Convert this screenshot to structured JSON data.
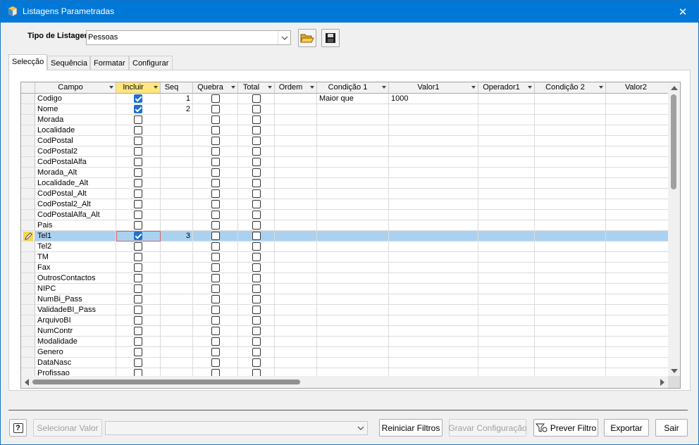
{
  "window": {
    "title": "Listagens Parametradas",
    "close_glyph": "✕"
  },
  "tipo": {
    "label": "Tipo de Listagem",
    "value": "Pessoas"
  },
  "tabs": [
    {
      "label": "Selecção",
      "active": true
    },
    {
      "label": "Sequência",
      "active": false
    },
    {
      "label": "Formatar",
      "active": false
    },
    {
      "label": "Configurar",
      "active": false
    }
  ],
  "grid": {
    "columns": [
      "Campo",
      "Incluir",
      "Seq",
      "Quebra",
      "Total",
      "Ordem",
      "Condição 1",
      "Valor1",
      "Operador1",
      "Condição 2",
      "Valor2"
    ],
    "sorted_column": "Incluir",
    "rows": [
      {
        "campo": "Codigo",
        "incluir": true,
        "seq": "1",
        "quebra": false,
        "total": false,
        "cond1": "Maior que",
        "valor1": "1000"
      },
      {
        "campo": "Nome",
        "incluir": true,
        "seq": "2",
        "quebra": false,
        "total": false,
        "cond1": "",
        "valor1": ""
      },
      {
        "campo": "Morada",
        "incluir": false,
        "seq": "",
        "quebra": false,
        "total": false,
        "cond1": "",
        "valor1": ""
      },
      {
        "campo": "Localidade",
        "incluir": false,
        "seq": "",
        "quebra": false,
        "total": false,
        "cond1": "",
        "valor1": ""
      },
      {
        "campo": "CodPostal",
        "incluir": false,
        "seq": "",
        "quebra": false,
        "total": false,
        "cond1": "",
        "valor1": ""
      },
      {
        "campo": "CodPostal2",
        "incluir": false,
        "seq": "",
        "quebra": false,
        "total": false,
        "cond1": "",
        "valor1": ""
      },
      {
        "campo": "CodPostalAlfa",
        "incluir": false,
        "seq": "",
        "quebra": false,
        "total": false,
        "cond1": "",
        "valor1": ""
      },
      {
        "campo": "Morada_Alt",
        "incluir": false,
        "seq": "",
        "quebra": false,
        "total": false,
        "cond1": "",
        "valor1": ""
      },
      {
        "campo": "Localidade_Alt",
        "incluir": false,
        "seq": "",
        "quebra": false,
        "total": false,
        "cond1": "",
        "valor1": ""
      },
      {
        "campo": "CodPostal_Alt",
        "incluir": false,
        "seq": "",
        "quebra": false,
        "total": false,
        "cond1": "",
        "valor1": ""
      },
      {
        "campo": "CodPostal2_Alt",
        "incluir": false,
        "seq": "",
        "quebra": false,
        "total": false,
        "cond1": "",
        "valor1": ""
      },
      {
        "campo": "CodPostalAlfa_Alt",
        "incluir": false,
        "seq": "",
        "quebra": false,
        "total": false,
        "cond1": "",
        "valor1": ""
      },
      {
        "campo": "Pais",
        "incluir": false,
        "seq": "",
        "quebra": false,
        "total": false,
        "cond1": "",
        "valor1": ""
      },
      {
        "campo": "Tel1",
        "incluir": true,
        "seq": "3",
        "quebra": false,
        "total": false,
        "cond1": "",
        "valor1": "",
        "selected": true
      },
      {
        "campo": "Tel2",
        "incluir": false,
        "seq": "",
        "quebra": false,
        "total": false,
        "cond1": "",
        "valor1": ""
      },
      {
        "campo": "TM",
        "incluir": false,
        "seq": "",
        "quebra": false,
        "total": false,
        "cond1": "",
        "valor1": ""
      },
      {
        "campo": "Fax",
        "incluir": false,
        "seq": "",
        "quebra": false,
        "total": false,
        "cond1": "",
        "valor1": ""
      },
      {
        "campo": "OutrosContactos",
        "incluir": false,
        "seq": "",
        "quebra": false,
        "total": false,
        "cond1": "",
        "valor1": ""
      },
      {
        "campo": "NIPC",
        "incluir": false,
        "seq": "",
        "quebra": false,
        "total": false,
        "cond1": "",
        "valor1": ""
      },
      {
        "campo": "NumBi_Pass",
        "incluir": false,
        "seq": "",
        "quebra": false,
        "total": false,
        "cond1": "",
        "valor1": ""
      },
      {
        "campo": "ValidadeBI_Pass",
        "incluir": false,
        "seq": "",
        "quebra": false,
        "total": false,
        "cond1": "",
        "valor1": ""
      },
      {
        "campo": "ArquivoBI",
        "incluir": false,
        "seq": "",
        "quebra": false,
        "total": false,
        "cond1": "",
        "valor1": ""
      },
      {
        "campo": "NumContr",
        "incluir": false,
        "seq": "",
        "quebra": false,
        "total": false,
        "cond1": "",
        "valor1": ""
      },
      {
        "campo": "Modalidade",
        "incluir": false,
        "seq": "",
        "quebra": false,
        "total": false,
        "cond1": "",
        "valor1": ""
      },
      {
        "campo": "Genero",
        "incluir": false,
        "seq": "",
        "quebra": false,
        "total": false,
        "cond1": "",
        "valor1": ""
      },
      {
        "campo": "DataNasc",
        "incluir": false,
        "seq": "",
        "quebra": false,
        "total": false,
        "cond1": "",
        "valor1": ""
      },
      {
        "campo": "Profissao",
        "incluir": false,
        "seq": "",
        "quebra": false,
        "total": false,
        "cond1": "",
        "valor1": ""
      }
    ]
  },
  "footer": {
    "help_glyph": "?",
    "selecionar_valor": "Selecionar Valor",
    "valor_value": "",
    "reiniciar": "Reiniciar Filtros",
    "gravar": "Gravar Configuração",
    "prever": "Prever Filtro",
    "exportar": "Exportar",
    "sair": "Sair"
  },
  "colors": {
    "titlebar": "#0078d7",
    "selection": "#aad2f0",
    "sorted_header": "#ffe680",
    "checkbox_on": "#1e6fd0"
  }
}
